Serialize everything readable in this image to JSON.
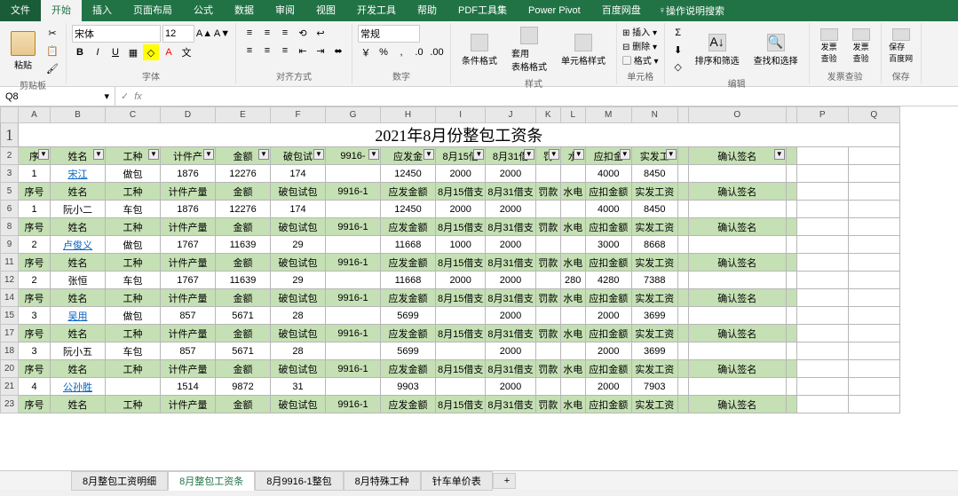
{
  "tabs": {
    "file": "文件",
    "home": "开始",
    "insert": "插入",
    "layout": "页面布局",
    "formula": "公式",
    "data": "数据",
    "review": "审阅",
    "view": "视图",
    "dev": "开发工具",
    "help": "帮助",
    "pdf": "PDF工具集",
    "pivot": "Power Pivot",
    "baidu": "百度网盘"
  },
  "search_hint": "操作说明搜索",
  "ribbon": {
    "paste": "粘贴",
    "clipboard": "剪贴板",
    "font": "字体",
    "font_name": "宋体",
    "font_size": "12",
    "align": "对齐方式",
    "number": "数字",
    "number_fmt": "常规",
    "styles": "样式",
    "cond": "条件格式",
    "tblfmt": "套用\n表格格式",
    "cellfmt": "单元格样式",
    "cells": "单元格",
    "ins": "插入",
    "del": "删除",
    "fmt": "格式",
    "edit": "编辑",
    "sort": "排序和筛选",
    "find": "查找和选择",
    "inv1": "发票\n查验",
    "inv2": "发票\n查验",
    "inv_grp": "发票查验",
    "save": "保存\n百度网",
    "save_grp": "保存"
  },
  "cellref": "Q8",
  "title": "2021年8月份整包工资条",
  "cols": [
    "A",
    "B",
    "C",
    "D",
    "E",
    "F",
    "G",
    "H",
    "I",
    "J",
    "K",
    "L",
    "M",
    "N",
    "",
    "O",
    "",
    "P",
    "Q"
  ],
  "header_labels": [
    "序号",
    "姓名",
    "工种",
    "计件产量",
    "金额",
    "破包试包",
    "9916-1",
    "应发金额",
    "8月15借支",
    "8月31借支",
    "罚款",
    "水电",
    "应扣金额",
    "实发工资",
    "确认签名"
  ],
  "header_short": [
    "序",
    "姓名",
    "工种",
    "计件产",
    "金额",
    "破包试",
    "9916-",
    "应发金",
    "8月15借",
    "8月31借",
    "罚",
    "水",
    "应扣金",
    "实发工",
    "确认签名"
  ],
  "chart_data": {
    "type": "table",
    "title": "2021年8月份整包工资条",
    "columns": [
      "序号",
      "姓名",
      "工种",
      "计件产量",
      "金额",
      "破包试包",
      "9916-1",
      "应发金额",
      "8月15借支",
      "8月31借支",
      "罚款",
      "水电",
      "应扣金额",
      "实发工资"
    ],
    "rows": [
      [
        "1",
        "宋江",
        "做包",
        "1876",
        "12276",
        "174",
        "",
        "12450",
        "2000",
        "2000",
        "",
        "",
        "4000",
        "8450"
      ],
      [
        "1",
        "阮小二",
        "车包",
        "1876",
        "12276",
        "174",
        "",
        "12450",
        "2000",
        "2000",
        "",
        "",
        "4000",
        "8450"
      ],
      [
        "2",
        "卢俊义",
        "做包",
        "1767",
        "11639",
        "29",
        "",
        "11668",
        "1000",
        "2000",
        "",
        "",
        "3000",
        "8668"
      ],
      [
        "2",
        "张恒",
        "车包",
        "1767",
        "11639",
        "29",
        "",
        "11668",
        "2000",
        "2000",
        "",
        "280",
        "4280",
        "7388"
      ],
      [
        "3",
        "吴用",
        "做包",
        "857",
        "5671",
        "28",
        "",
        "5699",
        "",
        "2000",
        "",
        "",
        "2000",
        "3699"
      ],
      [
        "3",
        "阮小五",
        "车包",
        "857",
        "5671",
        "28",
        "",
        "5699",
        "",
        "2000",
        "",
        "",
        "2000",
        "3699"
      ],
      [
        "4",
        "公孙胜",
        "",
        "1514",
        "9872",
        "31",
        "",
        "9903",
        "",
        "2000",
        "",
        "",
        "2000",
        "7903"
      ]
    ]
  },
  "row_nums": [
    "1",
    "2",
    "3",
    "5",
    "6",
    "8",
    "9",
    "11",
    "12",
    "14",
    "15",
    "17",
    "18",
    "20",
    "21",
    "23"
  ],
  "sheet_tabs": [
    "8月整包工资明细",
    "8月整包工资条",
    "8月9916-1整包",
    "8月特殊工种",
    "针车单价表"
  ]
}
